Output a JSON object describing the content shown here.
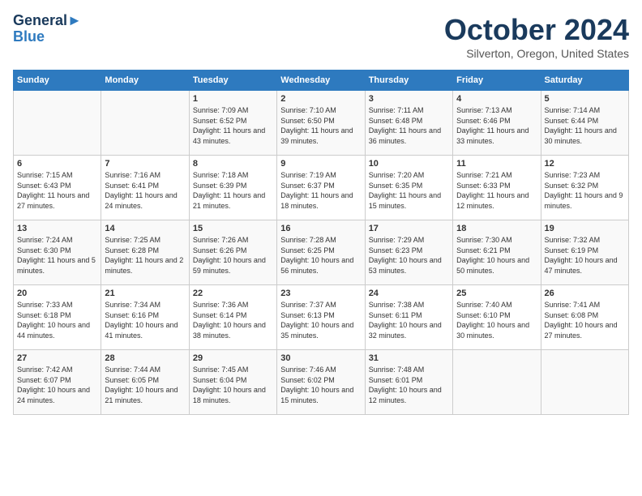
{
  "logo": {
    "line1": "General",
    "line2": "Blue"
  },
  "title": "October 2024",
  "subtitle": "Silverton, Oregon, United States",
  "days_of_week": [
    "Sunday",
    "Monday",
    "Tuesday",
    "Wednesday",
    "Thursday",
    "Friday",
    "Saturday"
  ],
  "weeks": [
    [
      {
        "day": "",
        "info": ""
      },
      {
        "day": "",
        "info": ""
      },
      {
        "day": "1",
        "info": "Sunrise: 7:09 AM\nSunset: 6:52 PM\nDaylight: 11 hours and 43 minutes."
      },
      {
        "day": "2",
        "info": "Sunrise: 7:10 AM\nSunset: 6:50 PM\nDaylight: 11 hours and 39 minutes."
      },
      {
        "day": "3",
        "info": "Sunrise: 7:11 AM\nSunset: 6:48 PM\nDaylight: 11 hours and 36 minutes."
      },
      {
        "day": "4",
        "info": "Sunrise: 7:13 AM\nSunset: 6:46 PM\nDaylight: 11 hours and 33 minutes."
      },
      {
        "day": "5",
        "info": "Sunrise: 7:14 AM\nSunset: 6:44 PM\nDaylight: 11 hours and 30 minutes."
      }
    ],
    [
      {
        "day": "6",
        "info": "Sunrise: 7:15 AM\nSunset: 6:43 PM\nDaylight: 11 hours and 27 minutes."
      },
      {
        "day": "7",
        "info": "Sunrise: 7:16 AM\nSunset: 6:41 PM\nDaylight: 11 hours and 24 minutes."
      },
      {
        "day": "8",
        "info": "Sunrise: 7:18 AM\nSunset: 6:39 PM\nDaylight: 11 hours and 21 minutes."
      },
      {
        "day": "9",
        "info": "Sunrise: 7:19 AM\nSunset: 6:37 PM\nDaylight: 11 hours and 18 minutes."
      },
      {
        "day": "10",
        "info": "Sunrise: 7:20 AM\nSunset: 6:35 PM\nDaylight: 11 hours and 15 minutes."
      },
      {
        "day": "11",
        "info": "Sunrise: 7:21 AM\nSunset: 6:33 PM\nDaylight: 11 hours and 12 minutes."
      },
      {
        "day": "12",
        "info": "Sunrise: 7:23 AM\nSunset: 6:32 PM\nDaylight: 11 hours and 9 minutes."
      }
    ],
    [
      {
        "day": "13",
        "info": "Sunrise: 7:24 AM\nSunset: 6:30 PM\nDaylight: 11 hours and 5 minutes."
      },
      {
        "day": "14",
        "info": "Sunrise: 7:25 AM\nSunset: 6:28 PM\nDaylight: 11 hours and 2 minutes."
      },
      {
        "day": "15",
        "info": "Sunrise: 7:26 AM\nSunset: 6:26 PM\nDaylight: 10 hours and 59 minutes."
      },
      {
        "day": "16",
        "info": "Sunrise: 7:28 AM\nSunset: 6:25 PM\nDaylight: 10 hours and 56 minutes."
      },
      {
        "day": "17",
        "info": "Sunrise: 7:29 AM\nSunset: 6:23 PM\nDaylight: 10 hours and 53 minutes."
      },
      {
        "day": "18",
        "info": "Sunrise: 7:30 AM\nSunset: 6:21 PM\nDaylight: 10 hours and 50 minutes."
      },
      {
        "day": "19",
        "info": "Sunrise: 7:32 AM\nSunset: 6:19 PM\nDaylight: 10 hours and 47 minutes."
      }
    ],
    [
      {
        "day": "20",
        "info": "Sunrise: 7:33 AM\nSunset: 6:18 PM\nDaylight: 10 hours and 44 minutes."
      },
      {
        "day": "21",
        "info": "Sunrise: 7:34 AM\nSunset: 6:16 PM\nDaylight: 10 hours and 41 minutes."
      },
      {
        "day": "22",
        "info": "Sunrise: 7:36 AM\nSunset: 6:14 PM\nDaylight: 10 hours and 38 minutes."
      },
      {
        "day": "23",
        "info": "Sunrise: 7:37 AM\nSunset: 6:13 PM\nDaylight: 10 hours and 35 minutes."
      },
      {
        "day": "24",
        "info": "Sunrise: 7:38 AM\nSunset: 6:11 PM\nDaylight: 10 hours and 32 minutes."
      },
      {
        "day": "25",
        "info": "Sunrise: 7:40 AM\nSunset: 6:10 PM\nDaylight: 10 hours and 30 minutes."
      },
      {
        "day": "26",
        "info": "Sunrise: 7:41 AM\nSunset: 6:08 PM\nDaylight: 10 hours and 27 minutes."
      }
    ],
    [
      {
        "day": "27",
        "info": "Sunrise: 7:42 AM\nSunset: 6:07 PM\nDaylight: 10 hours and 24 minutes."
      },
      {
        "day": "28",
        "info": "Sunrise: 7:44 AM\nSunset: 6:05 PM\nDaylight: 10 hours and 21 minutes."
      },
      {
        "day": "29",
        "info": "Sunrise: 7:45 AM\nSunset: 6:04 PM\nDaylight: 10 hours and 18 minutes."
      },
      {
        "day": "30",
        "info": "Sunrise: 7:46 AM\nSunset: 6:02 PM\nDaylight: 10 hours and 15 minutes."
      },
      {
        "day": "31",
        "info": "Sunrise: 7:48 AM\nSunset: 6:01 PM\nDaylight: 10 hours and 12 minutes."
      },
      {
        "day": "",
        "info": ""
      },
      {
        "day": "",
        "info": ""
      }
    ]
  ]
}
